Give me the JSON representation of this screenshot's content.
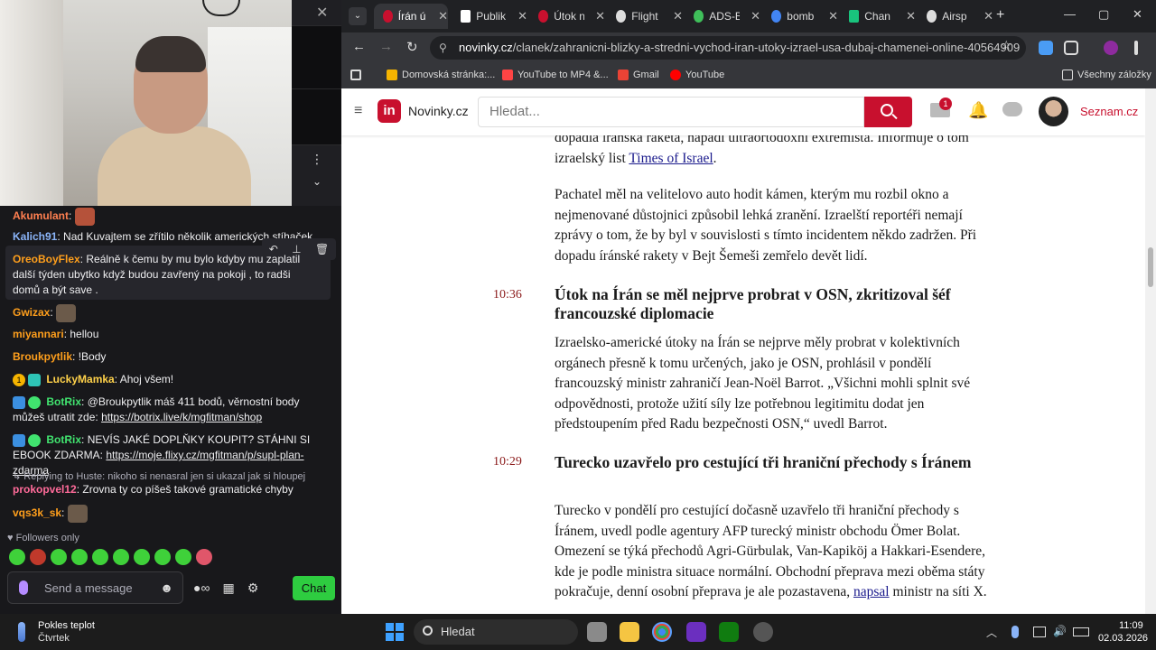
{
  "webcam": {
    "close_glyph": "✕",
    "menu_glyph": "⋮",
    "chevron_glyph": "⌄"
  },
  "chat": {
    "messages": [
      {
        "user": "Akumulant",
        "color": "#ff7f50",
        "text": ""
      },
      {
        "user": "Kalich91",
        "color": "#8ab4f8",
        "text": "Nad Kuvajtem se zřítilo několik amerických stíhaček"
      },
      {
        "user": "OreoBoyFlex",
        "color": "#ff9f1c",
        "text": "Reálně k čemu by mu bylo kdyby mu zaplatil další týden ubytko když budou zavřený na pokoji , to radši domů a být save ."
      },
      {
        "user": "Gwizax",
        "color": "#ff9f1c",
        "text": ""
      },
      {
        "user": "miyannari",
        "color": "#ff9f1c",
        "text": "hellou"
      },
      {
        "user": "Broukpytlik",
        "color": "#ff9f1c",
        "text": "!Body"
      },
      {
        "user": "LuckyMamka",
        "color": "#ffd24a",
        "text": "Ahoj všem!"
      },
      {
        "user": "BotRix",
        "color": "#41e36f",
        "text": "@Broukpytlik máš 411 bodů, věrnostní body můžeš utratit zde:",
        "link": "https://botrix.live/k/mgfitman/shop"
      },
      {
        "user": "BotRix",
        "color": "#41e36f",
        "text": "NEVÍS JAKÉ DOPLŇKY KOUPIT? STÁHNI SI EBOOK ZDARMA:",
        "link": "https://moje.flixy.cz/mgfitman/p/supl-plan-zdarma"
      },
      {
        "user": "prokopvel12",
        "color": "#ff6b9a",
        "text": "Zrovna ty co píšeš takové gramatické chyby"
      },
      {
        "user": "vqs3k_sk",
        "color": "#ff9f1c",
        "text": ""
      }
    ],
    "reply_to": "Replying to Huste: nikoho si nenasral jen si ukazal jak si hloupej",
    "followers_only": "Followers only",
    "input_placeholder": "Send a message",
    "chat_button": "Chat",
    "tool_undo": "↶",
    "tool_pin": "⊥",
    "tool_delete": "🗑",
    "lucky_badge": "1",
    "infinity": "∞",
    "gear": "⚙",
    "smile": "☻"
  },
  "browser": {
    "tabs": [
      {
        "title": "Írán ú",
        "color": "#c8102e",
        "active": true
      },
      {
        "title": "Publik",
        "color": "#ffffff"
      },
      {
        "title": "Útok n",
        "color": "#c8102e"
      },
      {
        "title": "Flight",
        "color": "#dddddd"
      },
      {
        "title": "ADS-B",
        "color": "#3fbf5a"
      },
      {
        "title": "bomb",
        "color": "#4285f4"
      },
      {
        "title": "Chan",
        "color": "#19c37d"
      },
      {
        "title": "Airsp",
        "color": "#dddddd"
      }
    ],
    "tab_close": "✕",
    "new_tab": "+",
    "tab_menu": "⌄",
    "win_min": "—",
    "win_max": "▢",
    "win_close": "✕",
    "back": "←",
    "forward": "→",
    "reload": "↻",
    "url_host": "novinky.cz",
    "url_path": "/clanek/zahranicni-blizky-a-stredni-vychod-iran-utoky-izrael-usa-dubaj-chamenei-online-40564909",
    "star": "☆",
    "tune": "⚲",
    "bookmarks": [
      {
        "label": "Domovská stránka:...",
        "color": "#f5b400"
      },
      {
        "label": "YouTube to MP4 &...",
        "color": "#ff4444"
      },
      {
        "label": "Gmail",
        "color": "#ea4335"
      },
      {
        "label": "YouTube",
        "color": "#ff0000"
      }
    ],
    "all_bookmarks": "Všechny záložky"
  },
  "site": {
    "hamburger": "≡",
    "logo_letter": "in",
    "name": "Novinky.cz",
    "search_placeholder": "Hledat...",
    "mail_count": "1",
    "bell": "🔔",
    "seznam": "Seznam.cz"
  },
  "article": {
    "p0_pre": "dopadla íránská raketa, napadl ultraortodoxní extremista. Informuje o tom izraelský list ",
    "p0_link": "Times of Israel",
    "p0_post": ".",
    "p1": "Pachatel měl na velitelovo auto hodit kámen, kterým mu rozbil okno a nejmenované důstojnici způsobil lehká zranění. Izraelští reportéři nemají zprávy o tom, že by byl v souvislosti s tímto incidentem někdo zadržen. Při dopadu íránské rakety v Bejt Šemeši zemřelo devět lidí.",
    "t1": "10:36",
    "h1": "Útok na Írán se měl nejprve probrat v OSN, zkritizoval šéf francouzské diplomacie",
    "p2": "Izraelsko-americké útoky na Írán se nejprve měly probrat v kolektivních orgánech přesně k tomu určených, jako je OSN, prohlásil v pondělí francouzský ministr zahraničí Jean-Noël Barrot. „Všichni mohli splnit své odpovědnosti, protože užití síly lze potřebnou legitimitu dodat jen předstoupením před Radu bezpečnosti OSN,“ uvedl Barrot.",
    "t2": "10:29",
    "h2": "Turecko uzavřelo pro cestující tři hraniční přechody s Íránem",
    "p3_pre": "Turecko v pondělí pro cestující dočasně uzavřelo tři hraniční přechody s Íránem, uvedl podle agentury AFP turecký ministr obchodu Ömer Bolat. Omezení se týká přechodů Agri-Gürbulak, Van-Kapiköj a Hakkari-Esendere, kde je podle ministra situace normální. Obchodní přeprava mezi oběma státy pokračuje, denní osobní přeprava je ale pozastavena, ",
    "p3_link": "napsal",
    "p3_post": " ministr na síti X."
  },
  "taskbar": {
    "weather_title": "Pokles teplot",
    "weather_sub": "Čtvrtek",
    "search": "Hledat",
    "time": "11:09",
    "date": "02.03.2026",
    "tray_up": "︿"
  }
}
